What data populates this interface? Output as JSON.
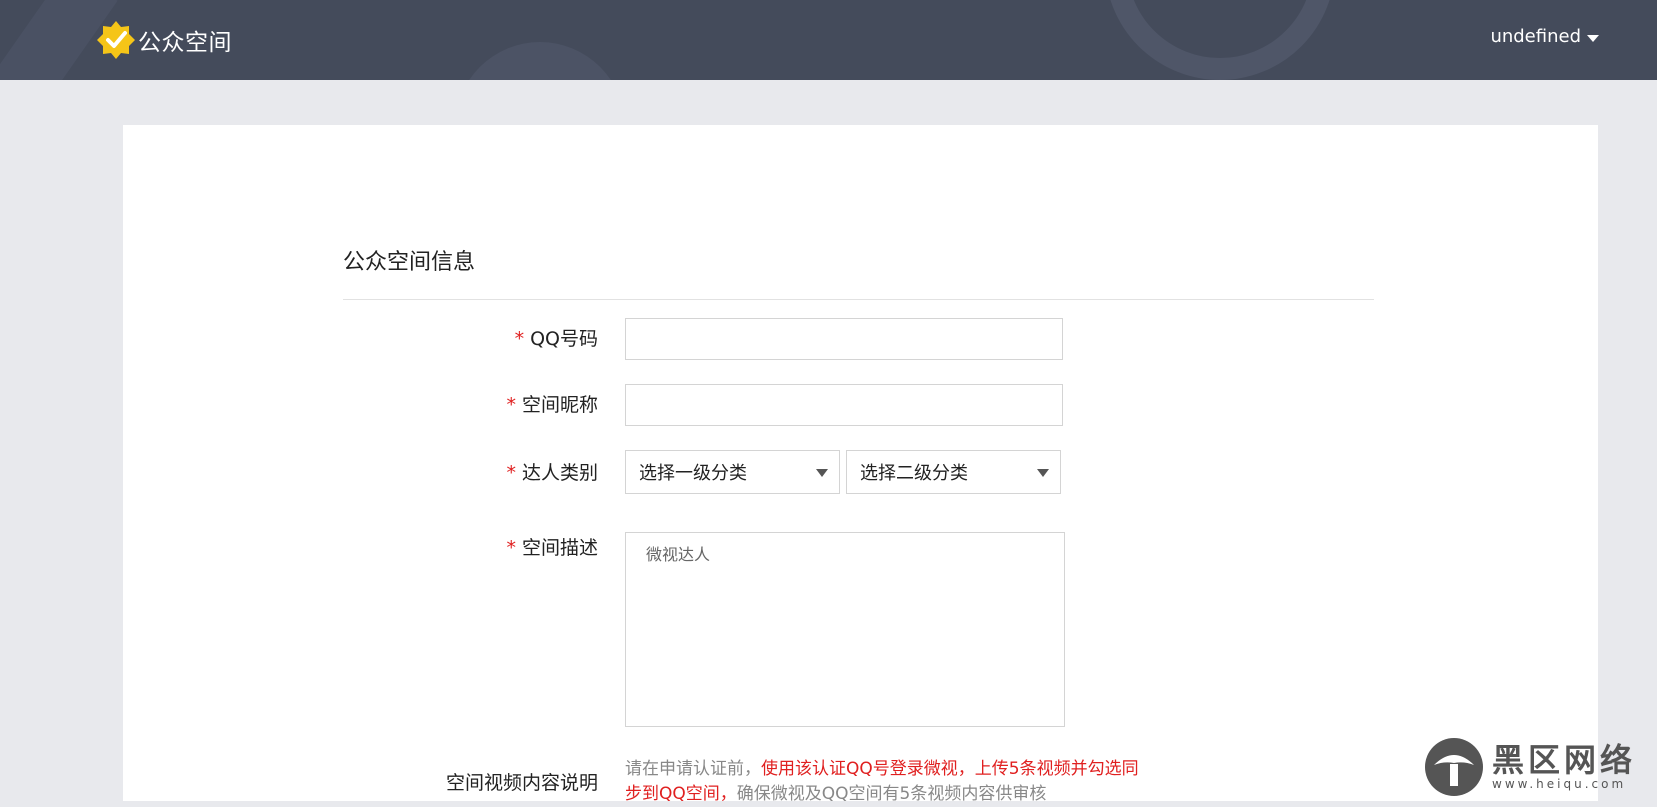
{
  "header": {
    "logo_text": "公众空间",
    "user_name": "undefined"
  },
  "form": {
    "section_title": "公众空间信息",
    "required_mark": "*",
    "qq_label": "QQ号码",
    "qq_value": "",
    "nickname_label": "空间昵称",
    "nickname_value": "",
    "category_label": "达人类别",
    "category_primary": "选择一级分类",
    "category_secondary": "选择二级分类",
    "description_label": "空间描述",
    "description_value": "微视达人",
    "video_label": "空间视频内容说明",
    "video_note_prefix": "请在申请认证前，",
    "video_note_highlight": "使用该认证QQ号登录微视，上传5条视频并勾选同步到QQ空间，",
    "video_note_suffix": "确保微视及QQ空间有5条视频内容供审核"
  },
  "watermark": {
    "title": "黑区网络",
    "url": "www.heiqu.com"
  },
  "colors": {
    "header_bg": "#444b5b",
    "page_bg": "#e8e9ed",
    "required_red": "#e02020",
    "logo_yellow": "#f5c518"
  }
}
